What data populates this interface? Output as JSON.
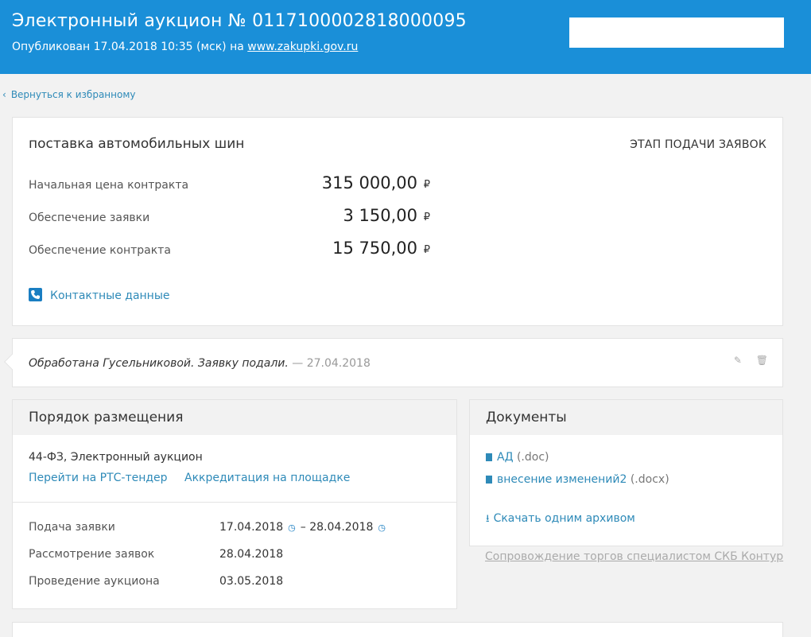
{
  "header": {
    "title": "Электронный аукцион № 0117100002818000095",
    "published_prefix": "Опубликован 17.04.2018 10:35 (мск) на",
    "published_link": "www.zakupki.gov.ru",
    "colors": {
      "background": "#1a8fd8"
    }
  },
  "back_link": {
    "label": "Вернуться к избранному"
  },
  "summary": {
    "title": "поставка автомобильных шин",
    "stage": "ЭТАП ПОДАЧИ ЗАЯВОК",
    "rows": [
      {
        "label": "Начальная цена контракта",
        "value": "315 000,00",
        "currency": "₽"
      },
      {
        "label": "Обеспечение заявки",
        "value": "3 150,00",
        "currency": "₽"
      },
      {
        "label": "Обеспечение контракта",
        "value": "15 750,00",
        "currency": "₽"
      }
    ],
    "contacts_label": "Контактные данные"
  },
  "note": {
    "text": "Обработана Гусельниковой. Заявку подали.",
    "date": "— 27.04.2018",
    "edit_icon": "pencil-icon",
    "delete_icon": "trash-icon"
  },
  "order": {
    "title": "Порядок размещения",
    "law": "44-ФЗ, Электронный аукцион",
    "links": [
      "Перейти на РТС-тендер",
      "Аккредитация на площадке"
    ],
    "schedule": [
      {
        "label": "Подача заявки",
        "from": "17.04.2018",
        "dash": "–",
        "to": "28.04.2018"
      },
      {
        "label": "Рассмотрение заявок",
        "value": "28.04.2018"
      },
      {
        "label": "Проведение аукциона",
        "value": "03.05.2018"
      }
    ]
  },
  "documents": {
    "title": "Документы",
    "items": [
      {
        "name": "АД",
        "ext": "(.doc)"
      },
      {
        "name": "внесение изменений2",
        "ext": "(.docx)"
      }
    ],
    "download_all": "Скачать одним архивом"
  },
  "support_link": "Сопровождение торгов специалистом СКБ Контур"
}
